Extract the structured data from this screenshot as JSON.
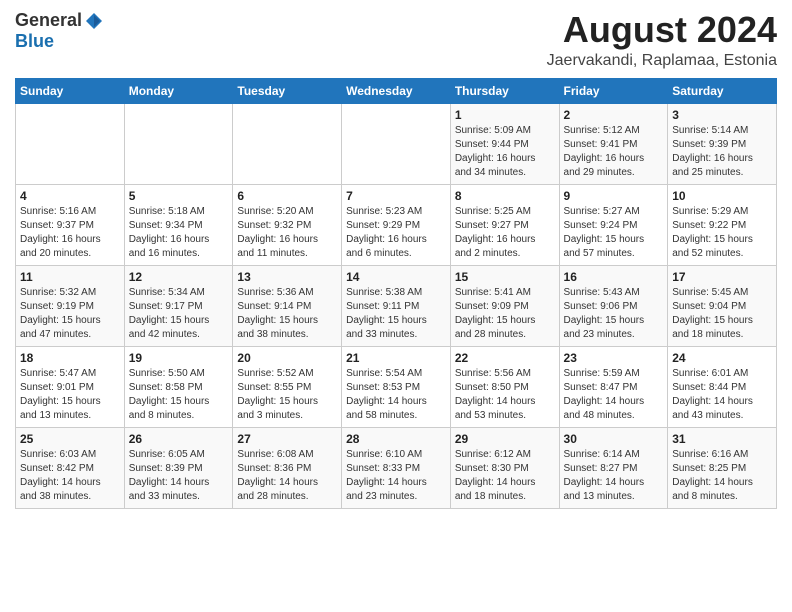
{
  "header": {
    "logo_general": "General",
    "logo_blue": "Blue",
    "month": "August 2024",
    "location": "Jaervakandi, Raplamaa, Estonia"
  },
  "weekdays": [
    "Sunday",
    "Monday",
    "Tuesday",
    "Wednesday",
    "Thursday",
    "Friday",
    "Saturday"
  ],
  "weeks": [
    [
      {
        "day": "",
        "info": ""
      },
      {
        "day": "",
        "info": ""
      },
      {
        "day": "",
        "info": ""
      },
      {
        "day": "",
        "info": ""
      },
      {
        "day": "1",
        "info": "Sunrise: 5:09 AM\nSunset: 9:44 PM\nDaylight: 16 hours\nand 34 minutes."
      },
      {
        "day": "2",
        "info": "Sunrise: 5:12 AM\nSunset: 9:41 PM\nDaylight: 16 hours\nand 29 minutes."
      },
      {
        "day": "3",
        "info": "Sunrise: 5:14 AM\nSunset: 9:39 PM\nDaylight: 16 hours\nand 25 minutes."
      }
    ],
    [
      {
        "day": "4",
        "info": "Sunrise: 5:16 AM\nSunset: 9:37 PM\nDaylight: 16 hours\nand 20 minutes."
      },
      {
        "day": "5",
        "info": "Sunrise: 5:18 AM\nSunset: 9:34 PM\nDaylight: 16 hours\nand 16 minutes."
      },
      {
        "day": "6",
        "info": "Sunrise: 5:20 AM\nSunset: 9:32 PM\nDaylight: 16 hours\nand 11 minutes."
      },
      {
        "day": "7",
        "info": "Sunrise: 5:23 AM\nSunset: 9:29 PM\nDaylight: 16 hours\nand 6 minutes."
      },
      {
        "day": "8",
        "info": "Sunrise: 5:25 AM\nSunset: 9:27 PM\nDaylight: 16 hours\nand 2 minutes."
      },
      {
        "day": "9",
        "info": "Sunrise: 5:27 AM\nSunset: 9:24 PM\nDaylight: 15 hours\nand 57 minutes."
      },
      {
        "day": "10",
        "info": "Sunrise: 5:29 AM\nSunset: 9:22 PM\nDaylight: 15 hours\nand 52 minutes."
      }
    ],
    [
      {
        "day": "11",
        "info": "Sunrise: 5:32 AM\nSunset: 9:19 PM\nDaylight: 15 hours\nand 47 minutes."
      },
      {
        "day": "12",
        "info": "Sunrise: 5:34 AM\nSunset: 9:17 PM\nDaylight: 15 hours\nand 42 minutes."
      },
      {
        "day": "13",
        "info": "Sunrise: 5:36 AM\nSunset: 9:14 PM\nDaylight: 15 hours\nand 38 minutes."
      },
      {
        "day": "14",
        "info": "Sunrise: 5:38 AM\nSunset: 9:11 PM\nDaylight: 15 hours\nand 33 minutes."
      },
      {
        "day": "15",
        "info": "Sunrise: 5:41 AM\nSunset: 9:09 PM\nDaylight: 15 hours\nand 28 minutes."
      },
      {
        "day": "16",
        "info": "Sunrise: 5:43 AM\nSunset: 9:06 PM\nDaylight: 15 hours\nand 23 minutes."
      },
      {
        "day": "17",
        "info": "Sunrise: 5:45 AM\nSunset: 9:04 PM\nDaylight: 15 hours\nand 18 minutes."
      }
    ],
    [
      {
        "day": "18",
        "info": "Sunrise: 5:47 AM\nSunset: 9:01 PM\nDaylight: 15 hours\nand 13 minutes."
      },
      {
        "day": "19",
        "info": "Sunrise: 5:50 AM\nSunset: 8:58 PM\nDaylight: 15 hours\nand 8 minutes."
      },
      {
        "day": "20",
        "info": "Sunrise: 5:52 AM\nSunset: 8:55 PM\nDaylight: 15 hours\nand 3 minutes."
      },
      {
        "day": "21",
        "info": "Sunrise: 5:54 AM\nSunset: 8:53 PM\nDaylight: 14 hours\nand 58 minutes."
      },
      {
        "day": "22",
        "info": "Sunrise: 5:56 AM\nSunset: 8:50 PM\nDaylight: 14 hours\nand 53 minutes."
      },
      {
        "day": "23",
        "info": "Sunrise: 5:59 AM\nSunset: 8:47 PM\nDaylight: 14 hours\nand 48 minutes."
      },
      {
        "day": "24",
        "info": "Sunrise: 6:01 AM\nSunset: 8:44 PM\nDaylight: 14 hours\nand 43 minutes."
      }
    ],
    [
      {
        "day": "25",
        "info": "Sunrise: 6:03 AM\nSunset: 8:42 PM\nDaylight: 14 hours\nand 38 minutes."
      },
      {
        "day": "26",
        "info": "Sunrise: 6:05 AM\nSunset: 8:39 PM\nDaylight: 14 hours\nand 33 minutes."
      },
      {
        "day": "27",
        "info": "Sunrise: 6:08 AM\nSunset: 8:36 PM\nDaylight: 14 hours\nand 28 minutes."
      },
      {
        "day": "28",
        "info": "Sunrise: 6:10 AM\nSunset: 8:33 PM\nDaylight: 14 hours\nand 23 minutes."
      },
      {
        "day": "29",
        "info": "Sunrise: 6:12 AM\nSunset: 8:30 PM\nDaylight: 14 hours\nand 18 minutes."
      },
      {
        "day": "30",
        "info": "Sunrise: 6:14 AM\nSunset: 8:27 PM\nDaylight: 14 hours\nand 13 minutes."
      },
      {
        "day": "31",
        "info": "Sunrise: 6:16 AM\nSunset: 8:25 PM\nDaylight: 14 hours\nand 8 minutes."
      }
    ]
  ]
}
